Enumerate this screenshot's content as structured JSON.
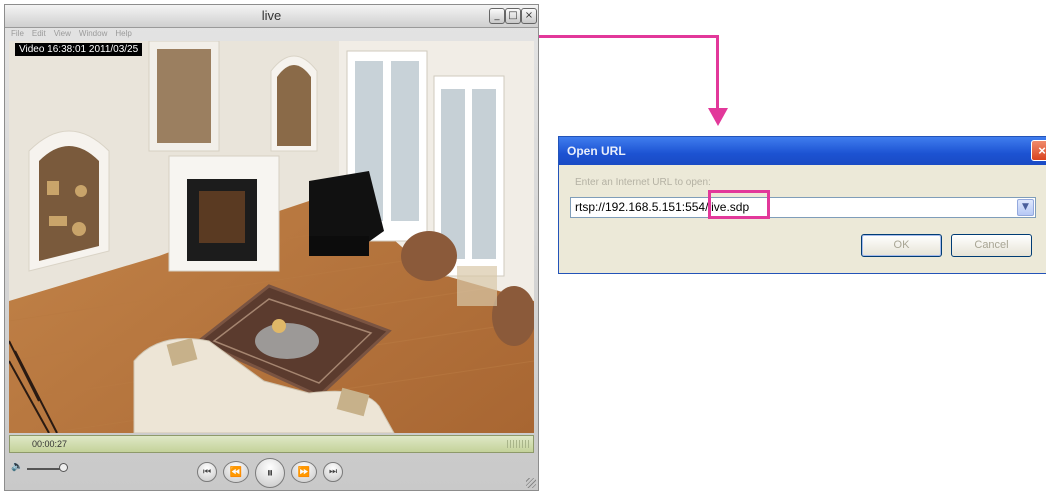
{
  "player": {
    "window_title": "live",
    "window_buttons": [
      "_",
      "□",
      "×"
    ],
    "menu": [
      "File",
      "Edit",
      "View",
      "Window",
      "Help"
    ],
    "osd_text": "Video 16:38:01 2011/03/25",
    "elapsed_time": "00:00:27",
    "volume_icon": "speaker-icon",
    "controls": {
      "to_start": "⏮",
      "rewind": "⏪",
      "pause": "⏸",
      "fast_forward": "⏩",
      "to_end": "⏭"
    }
  },
  "dialog": {
    "title": "Open URL",
    "close_label": "×",
    "prompt": "Enter an Internet URL to open:",
    "url_value": "rtsp://192.168.5.151:554/live.sdp",
    "ok_label": "OK",
    "cancel_label": "Cancel"
  },
  "colors": {
    "accent_highlight": "#e2389a",
    "dialog_title_bar": "#1c52d2"
  }
}
